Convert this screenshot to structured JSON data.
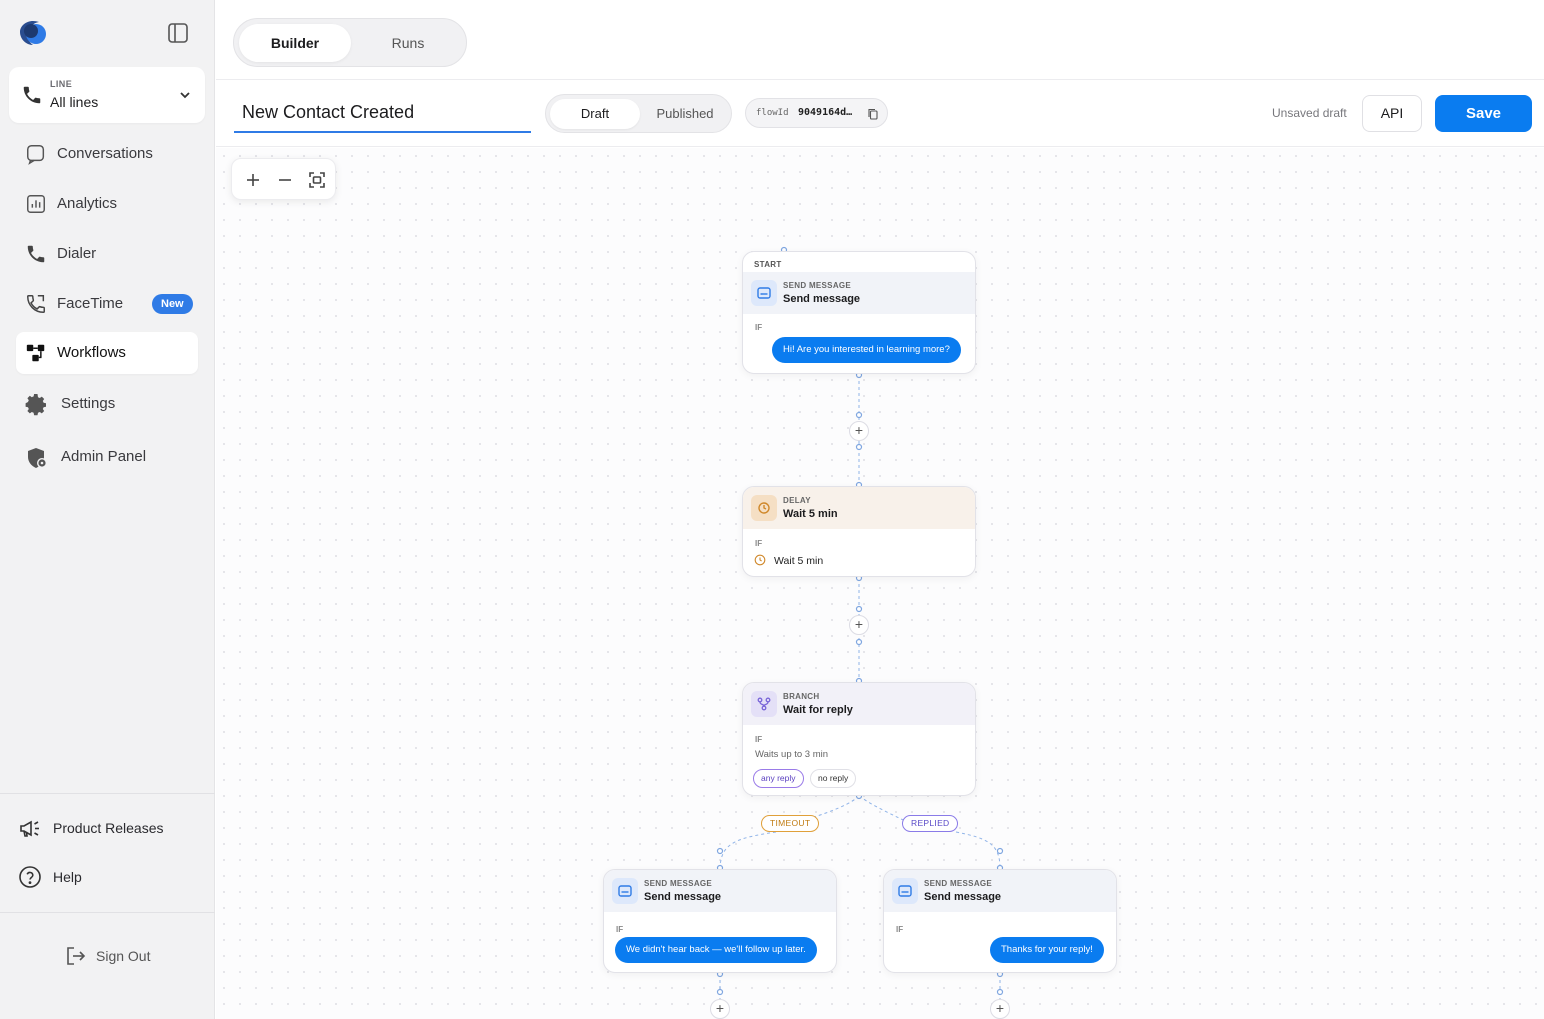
{
  "sidebar": {
    "line": {
      "label": "LINE",
      "value": "All lines"
    },
    "nav": [
      {
        "label": "Conversations",
        "icon": "chat-bubble-icon"
      },
      {
        "label": "Analytics",
        "icon": "bar-chart-icon"
      },
      {
        "label": "Dialer",
        "icon": "phone-icon"
      },
      {
        "label": "FaceTime",
        "icon": "facetime-icon",
        "badge": "New"
      },
      {
        "label": "Workflows",
        "icon": "workflow-icon",
        "active": true
      },
      {
        "label": "Settings",
        "icon": "gear-icon"
      },
      {
        "label": "Admin Panel",
        "icon": "shield-icon"
      }
    ],
    "bottom": [
      {
        "label": "Product Releases",
        "icon": "megaphone-icon"
      },
      {
        "label": "Help",
        "icon": "help-circle-icon"
      }
    ],
    "sign_out": "Sign Out"
  },
  "tabs": {
    "builder": "Builder",
    "runs": "Runs",
    "active": "Builder"
  },
  "flow": {
    "name": "New Contact Created",
    "status_tabs": {
      "draft": "Draft",
      "published": "Published",
      "active": "Draft"
    },
    "flow_id_key": "flowId",
    "flow_id_value": "9049164d…",
    "unsaved": "Unsaved draft",
    "api_label": "API",
    "save_label": "Save"
  },
  "canvas": {
    "nodes": {
      "start": {
        "start_label": "START",
        "kind": "SEND MESSAGE",
        "title": "Send message",
        "if_label": "IF",
        "message": "Hi! Are you interested in learning more?"
      },
      "delay": {
        "kind": "DELAY",
        "title": "Wait 5 min",
        "if_label": "IF",
        "detail": "Wait 5 min"
      },
      "branch": {
        "kind": "BRANCH",
        "title": "Wait for reply",
        "if_label": "IF",
        "detail": "Waits up to 3 min",
        "chips": [
          "any reply",
          "no reply"
        ]
      },
      "timeout_msg": {
        "kind": "SEND MESSAGE",
        "title": "Send message",
        "if_label": "IF",
        "message": "We didn't hear back — we'll follow up later."
      },
      "replied_msg": {
        "kind": "SEND MESSAGE",
        "title": "Send message",
        "if_label": "IF",
        "message": "Thanks for your reply!"
      }
    },
    "edge_labels": {
      "timeout": "TIMEOUT",
      "replied": "REPLIED"
    },
    "add_step": "+"
  },
  "colors": {
    "accent": "#0a7cf0",
    "badge": "#2f7be6",
    "timeout": "#e0a03a",
    "replied": "#8a7be8"
  }
}
